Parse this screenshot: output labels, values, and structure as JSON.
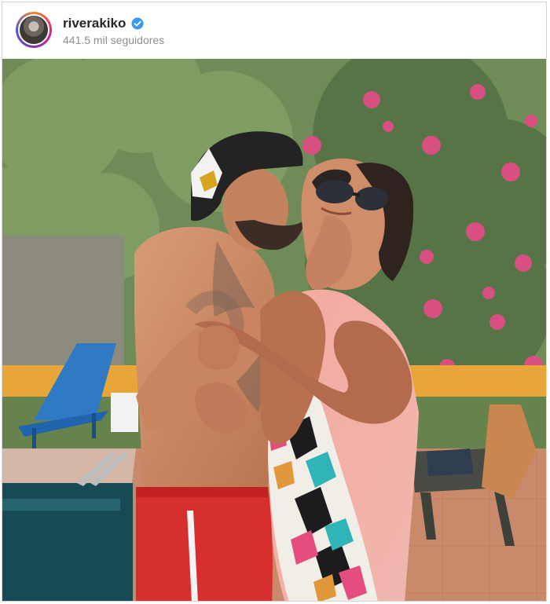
{
  "post": {
    "username": "riverakiko",
    "verified_icon": "verified-badge-icon",
    "followers": "441.5 mil seguidores",
    "colors": {
      "verified": "#3897f0",
      "username": "#262626",
      "secondary_text": "#8e8e8e"
    }
  }
}
